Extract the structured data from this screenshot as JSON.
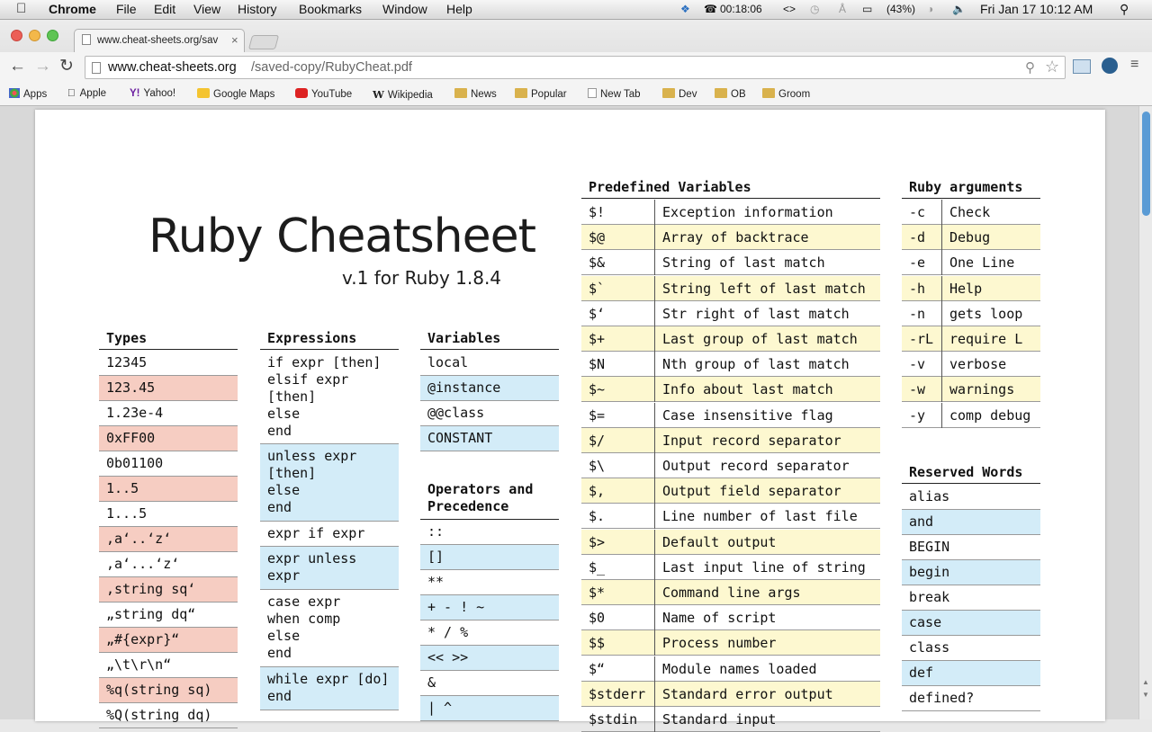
{
  "menubar": {
    "app": "Chrome",
    "items": [
      "File",
      "Edit",
      "View",
      "History",
      "Bookmarks",
      "Window",
      "Help"
    ],
    "timer": "00:18:06",
    "battery": "(43%)",
    "datetime": "Fri Jan 17  10:12 AM"
  },
  "tab": {
    "title": "www.cheat-sheets.org/sav"
  },
  "omnibox": {
    "domain": "www.cheat-sheets.org",
    "path": "/saved-copy/RubyCheat.pdf"
  },
  "bookmarks": [
    "Apps",
    "Apple",
    "Yahoo!",
    "Google Maps",
    "YouTube",
    "Wikipedia",
    "News",
    "Popular",
    "New Tab",
    "Dev",
    "OB",
    "Groom"
  ],
  "doc": {
    "title": "Ruby Cheatsheet",
    "subtitle": "v.1 for Ruby 1.8.4",
    "types": {
      "header": "Types",
      "rows": [
        "12345",
        "123.45",
        "1.23e-4",
        "0xFF00",
        "0b01100",
        "1..5",
        "1...5",
        ",a‘..‘z‘",
        ",a‘...‘z‘",
        ",string sq‘",
        "„string dq“",
        "„#{expr}“",
        "„\\t\\r\\n“",
        "%q(string sq)",
        "%Q(string dq)"
      ]
    },
    "expressions": {
      "header": "Expressions",
      "rows": [
        "if expr [then]\nelsif expr\n[then]\nelse\nend",
        "unless expr\n[then]\nelse\nend",
        "expr if expr",
        "expr unless\nexpr",
        "case expr\nwhen comp\nelse\nend",
        "while expr [do]\nend"
      ]
    },
    "variables": {
      "header": "Variables",
      "rows": [
        "local",
        "@instance",
        "@@class",
        "CONSTANT"
      ]
    },
    "operators": {
      "header": "Operators and\nPrecedence",
      "rows": [
        "::",
        "[]",
        "**",
        "+ - ! ~",
        "* / %",
        "<< >>",
        "&",
        "| ^"
      ]
    },
    "predefined": {
      "header": "Predefined Variables",
      "rows": [
        [
          "$!",
          "Exception information"
        ],
        [
          "$@",
          "Array of backtrace"
        ],
        [
          "$&",
          "String of last match"
        ],
        [
          "$`",
          "String left of last match"
        ],
        [
          "$‘",
          "Str right of last match"
        ],
        [
          "$+",
          "Last group of last match"
        ],
        [
          "$N",
          "Nth group of last match"
        ],
        [
          "$~",
          "Info about last match"
        ],
        [
          "$=",
          "Case insensitive flag"
        ],
        [
          "$/",
          "Input record separator"
        ],
        [
          "$\\",
          "Output record separator"
        ],
        [
          "$,",
          "Output field separator"
        ],
        [
          "$.",
          "Line number of last file"
        ],
        [
          "$>",
          "Default output"
        ],
        [
          "$_",
          "Last input line of string"
        ],
        [
          "$*",
          "Command line args"
        ],
        [
          "$0",
          "Name of script"
        ],
        [
          "$$",
          "Process number"
        ],
        [
          "$“",
          "Module names loaded"
        ],
        [
          "$stderr",
          "Standard error output"
        ],
        [
          "$stdin",
          "Standard input"
        ]
      ]
    },
    "arguments": {
      "header": "Ruby arguments",
      "rows": [
        [
          "-c",
          "Check"
        ],
        [
          "-d",
          "Debug"
        ],
        [
          "-e",
          "One Line"
        ],
        [
          "-h",
          "Help"
        ],
        [
          "-n",
          "gets loop"
        ],
        [
          "-rL",
          "require L"
        ],
        [
          "-v",
          "verbose"
        ],
        [
          "-w",
          "warnings"
        ],
        [
          "-y",
          "comp debug"
        ]
      ]
    },
    "reserved": {
      "header": "Reserved Words",
      "rows": [
        "alias",
        "and",
        "BEGIN",
        "begin",
        "break",
        "case",
        "class",
        "def",
        "defined?"
      ]
    }
  }
}
